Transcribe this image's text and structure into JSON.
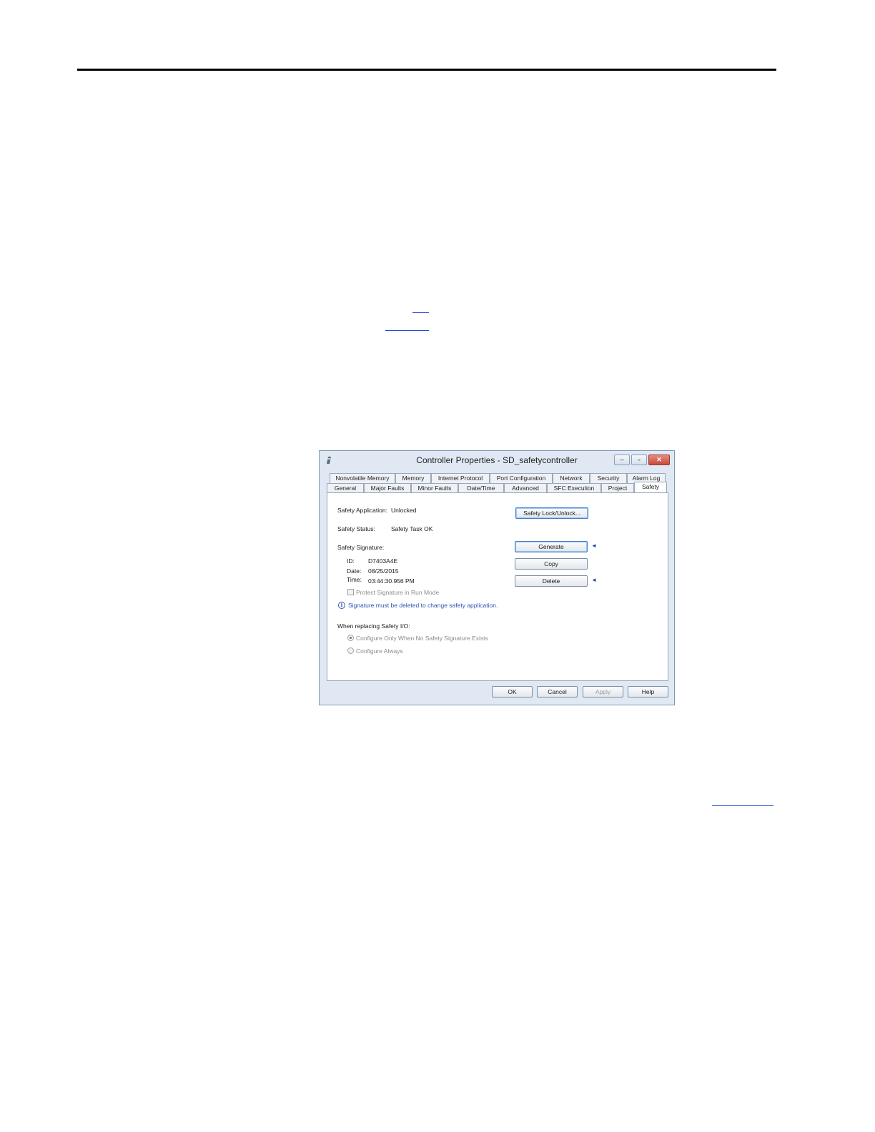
{
  "dialog": {
    "title": "Controller Properties - SD_safetycontroller",
    "window_buttons": {
      "minimize": "‒",
      "maximize": "▫",
      "close": "✕"
    },
    "tabs_row1": [
      "Nonvolatile Memory",
      "Memory",
      "Internet Protocol",
      "Port Configuration",
      "Network",
      "Security",
      "Alarm Log"
    ],
    "tabs_row2": [
      "General",
      "Major Faults",
      "Minor Faults",
      "Date/Time",
      "Advanced",
      "SFC Execution",
      "Project",
      "Safety"
    ],
    "safety": {
      "application_label": "Safety Application:",
      "application_value": "Unlocked",
      "status_label": "Safety Status:",
      "status_value": "Safety Task OK",
      "signature_label": "Safety Signature:",
      "id_label": "ID:",
      "id_value": "D7403A4E",
      "date_label": "Date:",
      "date_value": "08/25/2015",
      "time_label": "Time:",
      "time_value": "03:44:30.956 PM",
      "protect_label": "Protect Signature in Run Mode",
      "info_text": "Signature must be deleted to change safety application.",
      "replacing_label": "When replacing Safety I/O:",
      "option_configure_only": "Configure Only When No Safety Signature Exists",
      "option_configure_always": "Configure Always",
      "lock_button": "Safety Lock/Unlock...",
      "generate_button": "Generate",
      "copy_button": "Copy",
      "delete_button": "Delete"
    },
    "footer": {
      "ok": "OK",
      "cancel": "Cancel",
      "apply": "Apply",
      "help": "Help"
    }
  }
}
